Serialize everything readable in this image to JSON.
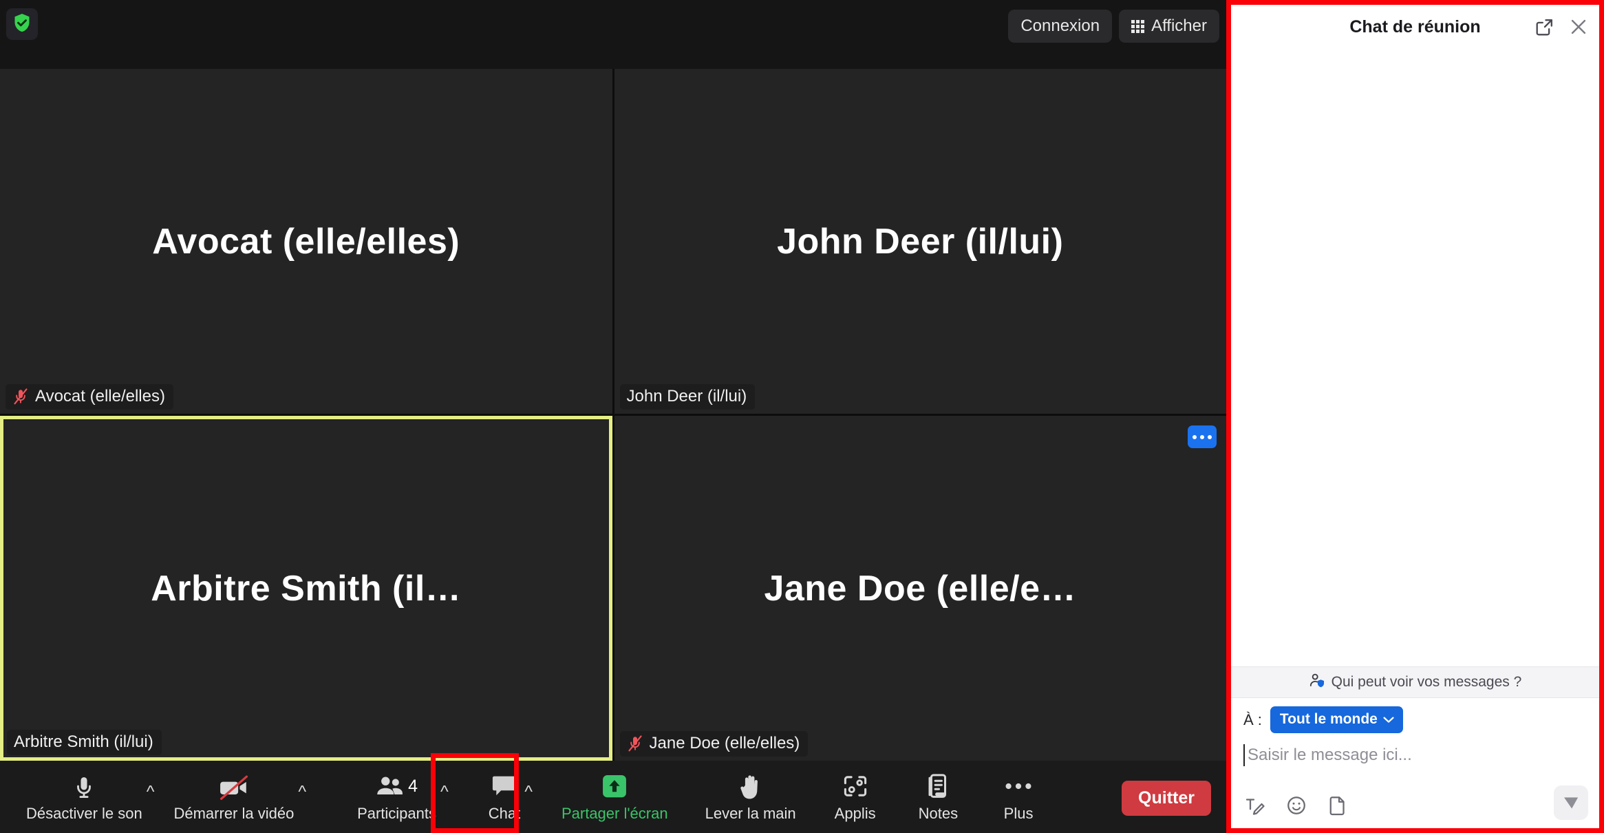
{
  "meeting": {
    "topbar": {
      "encryption_icon": "shield-check-icon",
      "connection_label": "Connexion",
      "view_label": "Afficher",
      "view_icon": "grid-icon"
    },
    "participants": [
      {
        "display_name": "Avocat (elle/elles)",
        "name_label": "Avocat (elle/elles)",
        "muted": true,
        "active_speaker": false,
        "has_more_menu": false
      },
      {
        "display_name": "John Deer (il/lui)",
        "name_label": "John Deer (il/lui)",
        "muted": false,
        "active_speaker": false,
        "has_more_menu": false
      },
      {
        "display_name": "Arbitre Smith (il…",
        "name_label": "Arbitre Smith (il/lui)",
        "muted": false,
        "active_speaker": true,
        "has_more_menu": false
      },
      {
        "display_name": "Jane Doe (elle/e…",
        "name_label": "Jane Doe (elle/elles)",
        "muted": true,
        "active_speaker": false,
        "has_more_menu": true
      }
    ],
    "toolbar": {
      "mute_label": "Désactiver le son",
      "mute_icon": "microphone-icon",
      "video_label": "Démarrer la vidéo",
      "video_icon": "camera-off-icon",
      "participants_label": "Participants",
      "participants_icon": "people-icon",
      "participants_count": "4",
      "chat_label": "Chat",
      "chat_icon": "chat-bubble-icon",
      "share_label": "Partager l'écran",
      "share_icon": "share-screen-icon",
      "hand_label": "Lever la main",
      "hand_icon": "raise-hand-icon",
      "apps_label": "Applis",
      "apps_icon": "apps-icon",
      "notes_label": "Notes",
      "notes_icon": "notes-icon",
      "more_label": "Plus",
      "more_icon": "ellipsis-icon",
      "leave_label": "Quitter"
    }
  },
  "chat": {
    "title": "Chat de réunion",
    "popout_icon": "pop-out-icon",
    "close_icon": "close-icon",
    "permission_text": "Qui peut voir vos messages ?",
    "permission_icon": "person-shield-icon",
    "to_label": "À :",
    "to_value": "Tout le monde",
    "to_chevron_icon": "chevron-down-icon",
    "message_placeholder": "Saisir le message ici...",
    "tools": {
      "format_icon": "text-format-icon",
      "emoji_icon": "emoji-icon",
      "file_icon": "file-icon",
      "send_icon": "send-icon"
    }
  },
  "annotations": {
    "highlight_color": "#fb0007",
    "active_speaker_color": "#e4ee84",
    "accent_blue": "#1668dc",
    "leave_red": "#cf3b40",
    "share_green": "#3ac46a"
  }
}
